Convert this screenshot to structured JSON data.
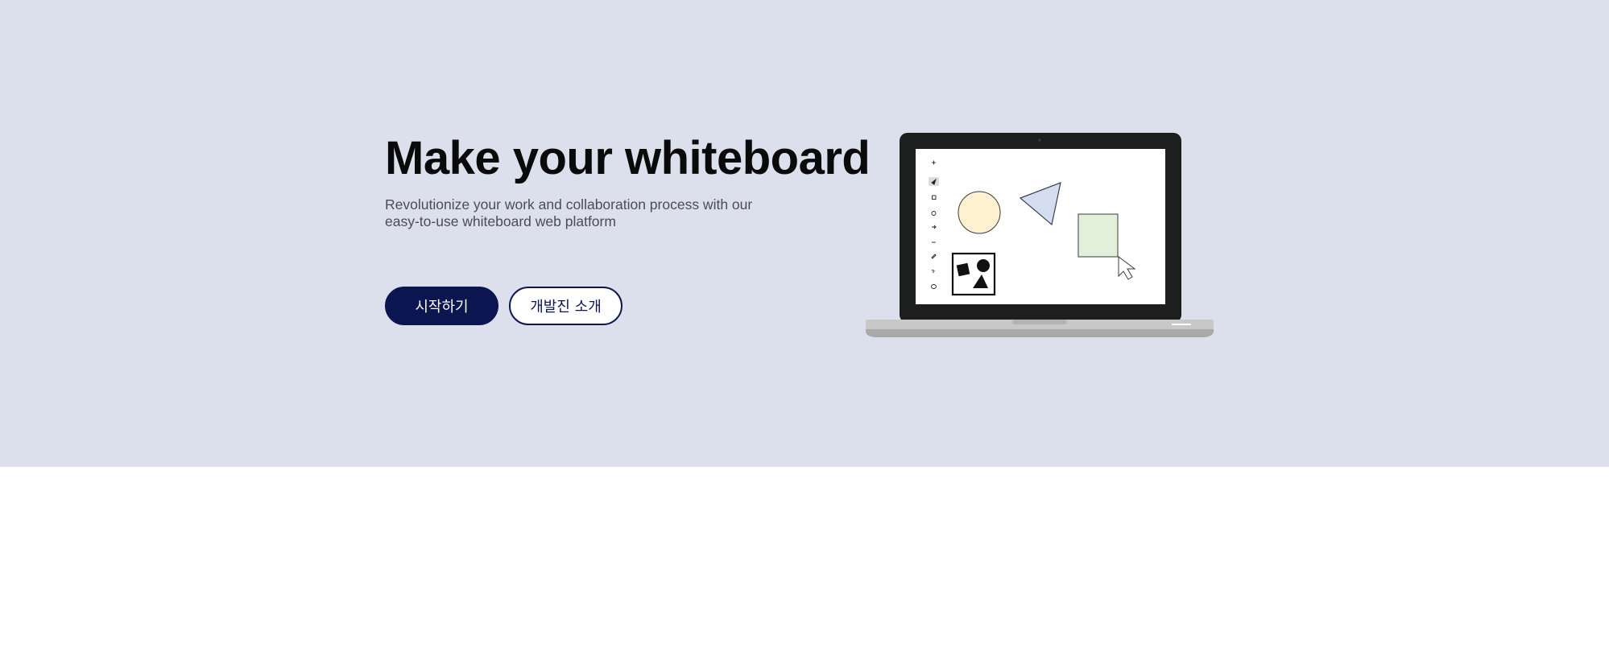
{
  "hero": {
    "title": "Make your whiteboard",
    "subtitle": "Revolutionize your work and collaboration process with our easy-to-use whiteboard web platform",
    "primary_button": "시작하기",
    "secondary_button": "개발진 소개"
  },
  "illustration": {
    "toolbar_icons": [
      "plus-icon",
      "select-icon",
      "square-icon",
      "circle-icon",
      "arrow-icon",
      "line-icon",
      "pen-icon",
      "text-icon",
      "lasso-icon"
    ],
    "colors": {
      "background": "#dcdfec",
      "primary": "#0b1650",
      "circle_fill": "#fdf1d0",
      "triangle_fill": "#d4dcf0",
      "square_fill": "#e2f0db"
    }
  }
}
